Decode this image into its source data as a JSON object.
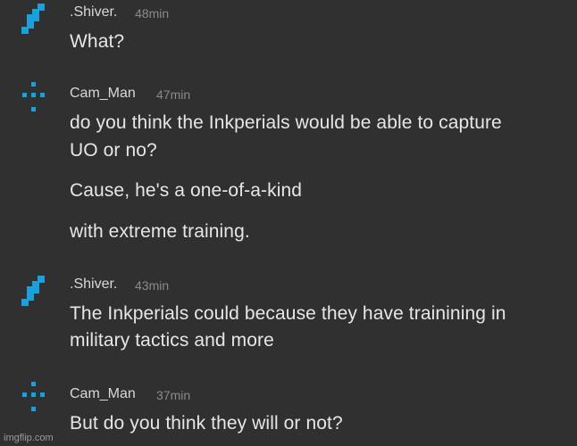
{
  "accent_color": "#1aa0dc",
  "messages": [
    {
      "username": ".Shiver.",
      "time": "48min",
      "avatar_icon": "shiver-pixel-avatar-icon",
      "lines": [
        "What?"
      ]
    },
    {
      "username": "Cam_Man",
      "time": "47min",
      "avatar_icon": "camman-pixel-avatar-icon",
      "lines": [
        "do you think the Inkperials would be able to capture",
        "UO or no?",
        "Cause, he's a one-of-a-kind",
        "with extreme training."
      ]
    },
    {
      "username": ".Shiver.",
      "time": "43min",
      "avatar_icon": "shiver-pixel-avatar-icon",
      "lines": [
        "The Inkperials could because they have trainining in",
        "military tactics and more"
      ]
    },
    {
      "username": "Cam_Man",
      "time": "37min",
      "avatar_icon": "camman-pixel-avatar-icon",
      "lines": [
        "But do you think they will or not?"
      ]
    }
  ],
  "watermark": "imgflip.com"
}
